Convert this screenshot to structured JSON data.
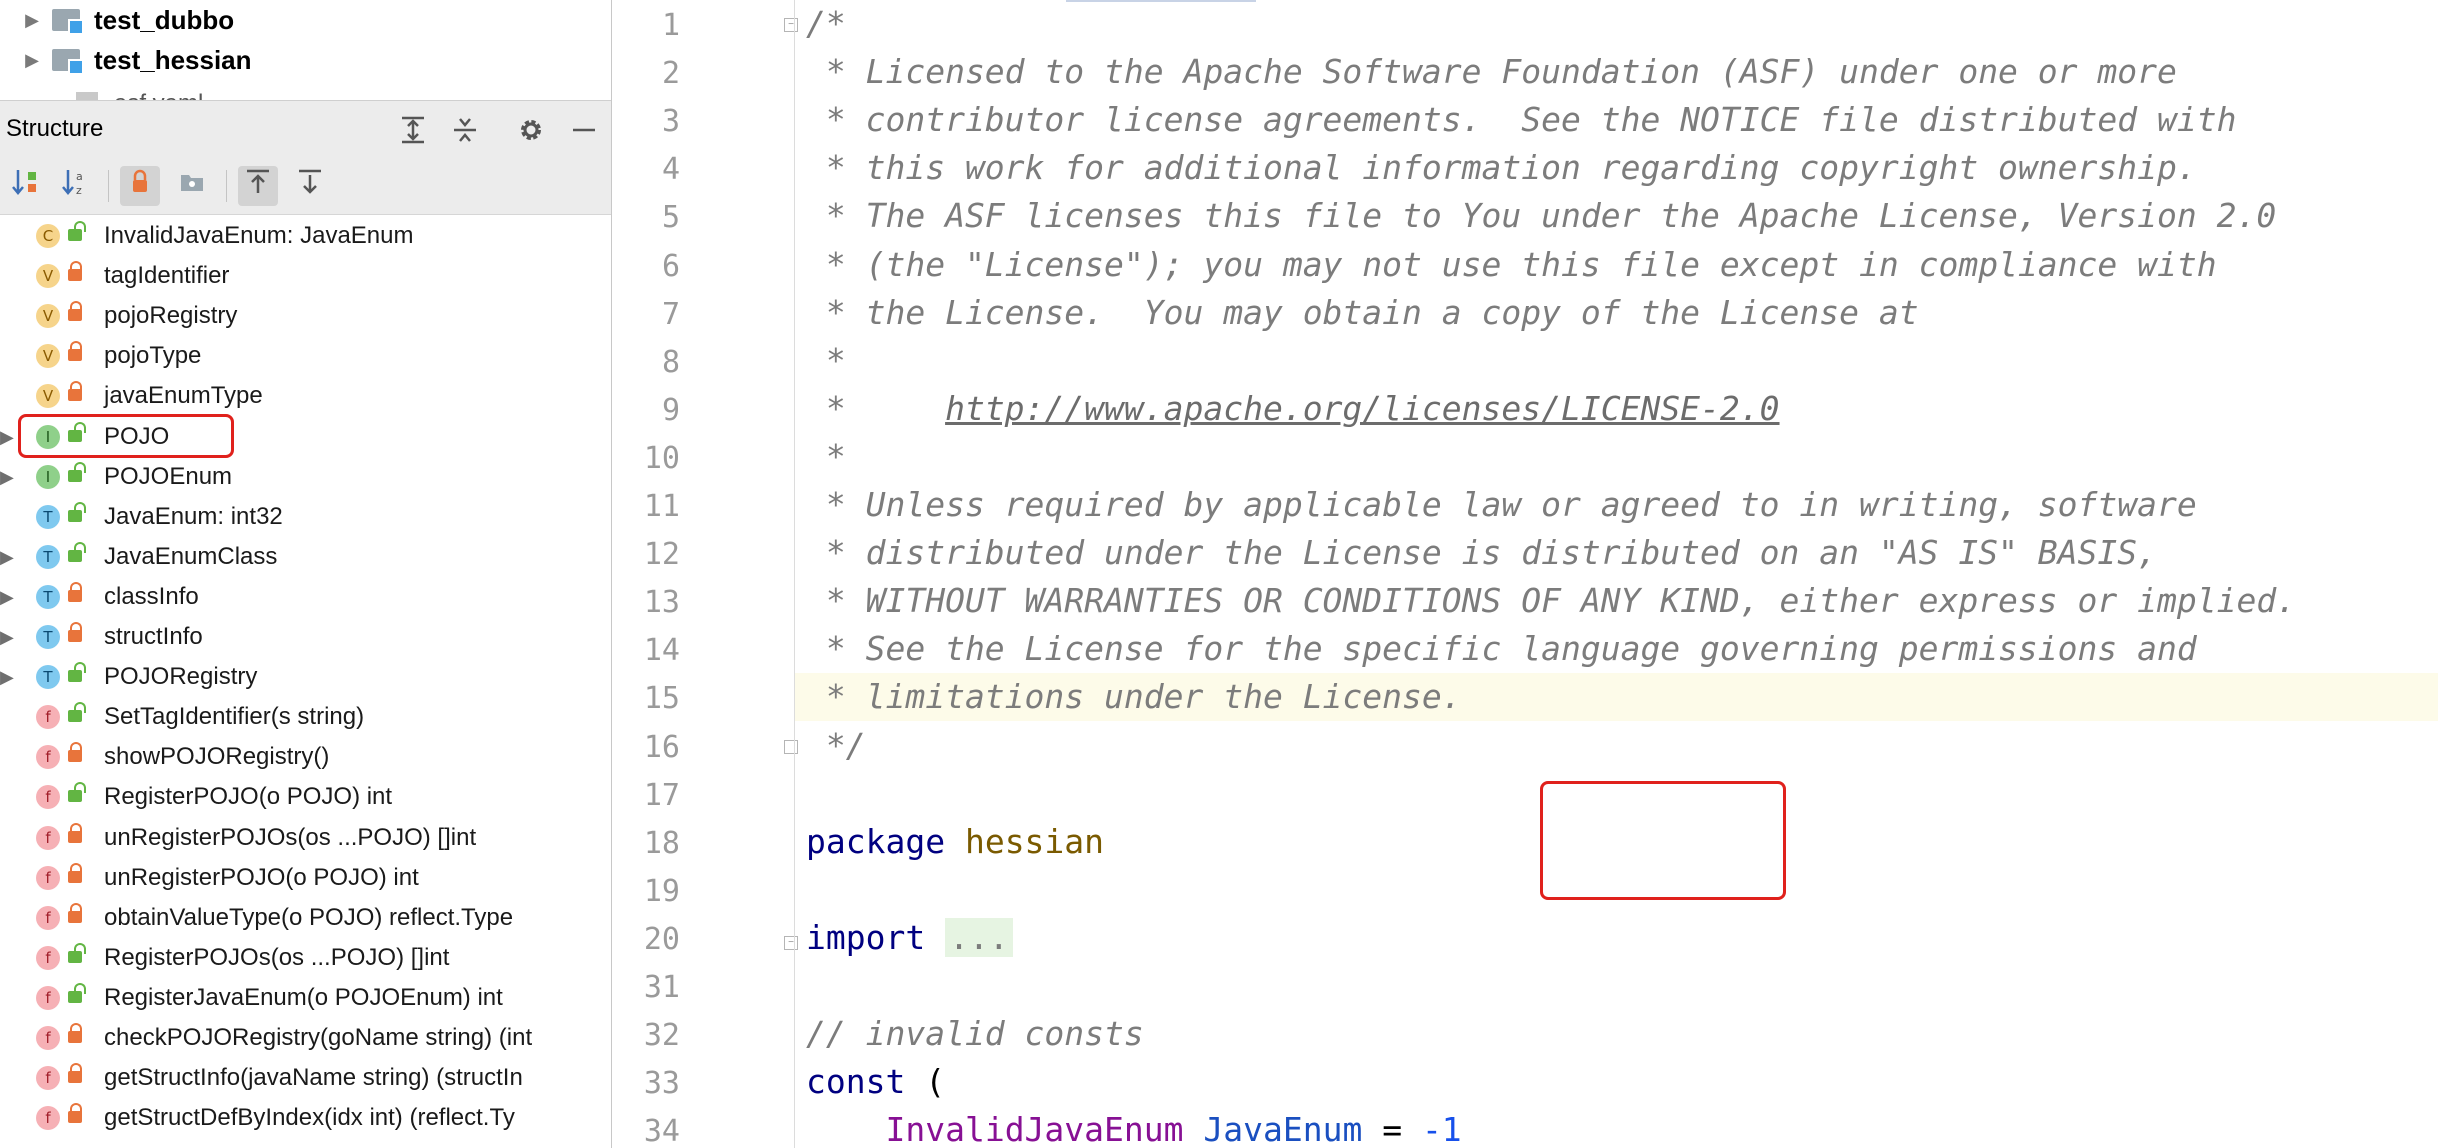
{
  "project_tree": [
    {
      "name": "test_dubbo"
    },
    {
      "name": "test_hessian"
    },
    {
      "name": "asf.yaml"
    }
  ],
  "structure": {
    "title": "Structure",
    "header_icons": [
      "expand-all-icon",
      "collapse-all-icon",
      "gear-icon",
      "minimize-icon"
    ],
    "toolbar_icons": [
      "sort-by-visibility-icon",
      "sort-alphabetically-icon",
      "show-non-public-icon",
      "show-fields-icon",
      "autoscroll-to-source-icon",
      "autoscroll-from-source-icon"
    ],
    "items": [
      {
        "kind": "C",
        "expandable": false,
        "label": "InvalidJavaEnum: JavaEnum",
        "visibility": "public"
      },
      {
        "kind": "V",
        "expandable": false,
        "label": "tagIdentifier",
        "visibility": "private"
      },
      {
        "kind": "V",
        "expandable": false,
        "label": "pojoRegistry",
        "visibility": "private"
      },
      {
        "kind": "V",
        "expandable": false,
        "label": "pojoType",
        "visibility": "private"
      },
      {
        "kind": "V",
        "expandable": false,
        "label": "javaEnumType",
        "visibility": "private"
      },
      {
        "kind": "I",
        "expandable": true,
        "label": "POJO",
        "visibility": "public"
      },
      {
        "kind": "I",
        "expandable": true,
        "label": "POJOEnum",
        "visibility": "public"
      },
      {
        "kind": "T",
        "expandable": false,
        "label": "JavaEnum: int32",
        "visibility": "public"
      },
      {
        "kind": "T",
        "expandable": true,
        "label": "JavaEnumClass",
        "visibility": "public"
      },
      {
        "kind": "T",
        "expandable": true,
        "label": "classInfo",
        "visibility": "private"
      },
      {
        "kind": "T",
        "expandable": true,
        "label": "structInfo",
        "visibility": "private"
      },
      {
        "kind": "T",
        "expandable": true,
        "label": "POJORegistry",
        "visibility": "public"
      },
      {
        "kind": "f",
        "expandable": false,
        "label": "SetTagIdentifier(s string)",
        "visibility": "public"
      },
      {
        "kind": "f",
        "expandable": false,
        "label": "showPOJORegistry()",
        "visibility": "private"
      },
      {
        "kind": "f",
        "expandable": false,
        "label": "RegisterPOJO(o POJO) int",
        "visibility": "public"
      },
      {
        "kind": "f",
        "expandable": false,
        "label": "unRegisterPOJOs(os ...POJO) []int",
        "visibility": "private"
      },
      {
        "kind": "f",
        "expandable": false,
        "label": "unRegisterPOJO(o POJO) int",
        "visibility": "private"
      },
      {
        "kind": "f",
        "expandable": false,
        "label": "obtainValueType(o POJO) reflect.Type",
        "visibility": "private"
      },
      {
        "kind": "f",
        "expandable": false,
        "label": "RegisterPOJOs(os ...POJO) []int",
        "visibility": "public"
      },
      {
        "kind": "f",
        "expandable": false,
        "label": "RegisterJavaEnum(o POJOEnum) int",
        "visibility": "public"
      },
      {
        "kind": "f",
        "expandable": false,
        "label": "checkPOJORegistry(goName string) (int",
        "visibility": "private"
      },
      {
        "kind": "f",
        "expandable": false,
        "label": "getStructInfo(javaName string) (structIn",
        "visibility": "private"
      },
      {
        "kind": "f",
        "expandable": false,
        "label": "getStructDefByIndex(idx int) (reflect.Ty",
        "visibility": "private"
      }
    ]
  },
  "badge_colors": {
    "C": {
      "bg": "#f6d48b",
      "fg": "#8a5a00"
    },
    "V": {
      "bg": "#f6d48b",
      "fg": "#8a5a00"
    },
    "I": {
      "bg": "#8fd08a",
      "fg": "#1f5a1c"
    },
    "T": {
      "bg": "#7fc9ef",
      "fg": "#0b4a72"
    },
    "f": {
      "bg": "#f6b0b5",
      "fg": "#a11f2a"
    }
  },
  "visibility_colors": {
    "public": "#62b543",
    "private": "#e8743b"
  },
  "editor": {
    "current_line": 15,
    "lines": [
      {
        "n": "1",
        "text": "/*"
      },
      {
        "n": "2",
        "text": " * Licensed to the Apache Software Foundation (ASF) under one or more"
      },
      {
        "n": "3",
        "text": " * contributor license agreements.  See the NOTICE file distributed with"
      },
      {
        "n": "4",
        "text": " * this work for additional information regarding copyright ownership."
      },
      {
        "n": "5",
        "text": " * The ASF licenses this file to You under the Apache License, Version 2.0"
      },
      {
        "n": "6",
        "text": " * (the \"License\"); you may not use this file except in compliance with"
      },
      {
        "n": "7",
        "text": " * the License.  You may obtain a copy of the License at"
      },
      {
        "n": "8",
        "text": " *"
      },
      {
        "n": "9",
        "text_prefix": " *     ",
        "url": "http://www.apache.org/licenses/LICENSE-2.0"
      },
      {
        "n": "10",
        "text": " *"
      },
      {
        "n": "11",
        "text": " * Unless required by applicable law or agreed to in writing, software"
      },
      {
        "n": "12",
        "text": " * distributed under the License is distributed on an \"AS IS\" BASIS,"
      },
      {
        "n": "13",
        "text": " * WITHOUT WARRANTIES OR CONDITIONS OF ANY KIND, either express or implied."
      },
      {
        "n": "14",
        "text": " * See the License for the specific language governing permissions and"
      },
      {
        "n": "15",
        "text": " * limitations under the License."
      },
      {
        "n": "16",
        "text": " */"
      },
      {
        "n": "17",
        "text": ""
      },
      {
        "n": "18",
        "keyword": "package",
        "name": "hessian"
      },
      {
        "n": "19",
        "text": ""
      },
      {
        "n": "20",
        "keyword": "import",
        "folded": "..."
      },
      {
        "n": "31",
        "text": ""
      },
      {
        "n": "32",
        "text": "// invalid consts"
      },
      {
        "n": "33",
        "keyword": "const",
        "rest": " ("
      },
      {
        "n": "34",
        "indent": "    ",
        "var": "InvalidJavaEnum",
        "type": "JavaEnum",
        "op": " = ",
        "num": "-1"
      }
    ]
  }
}
